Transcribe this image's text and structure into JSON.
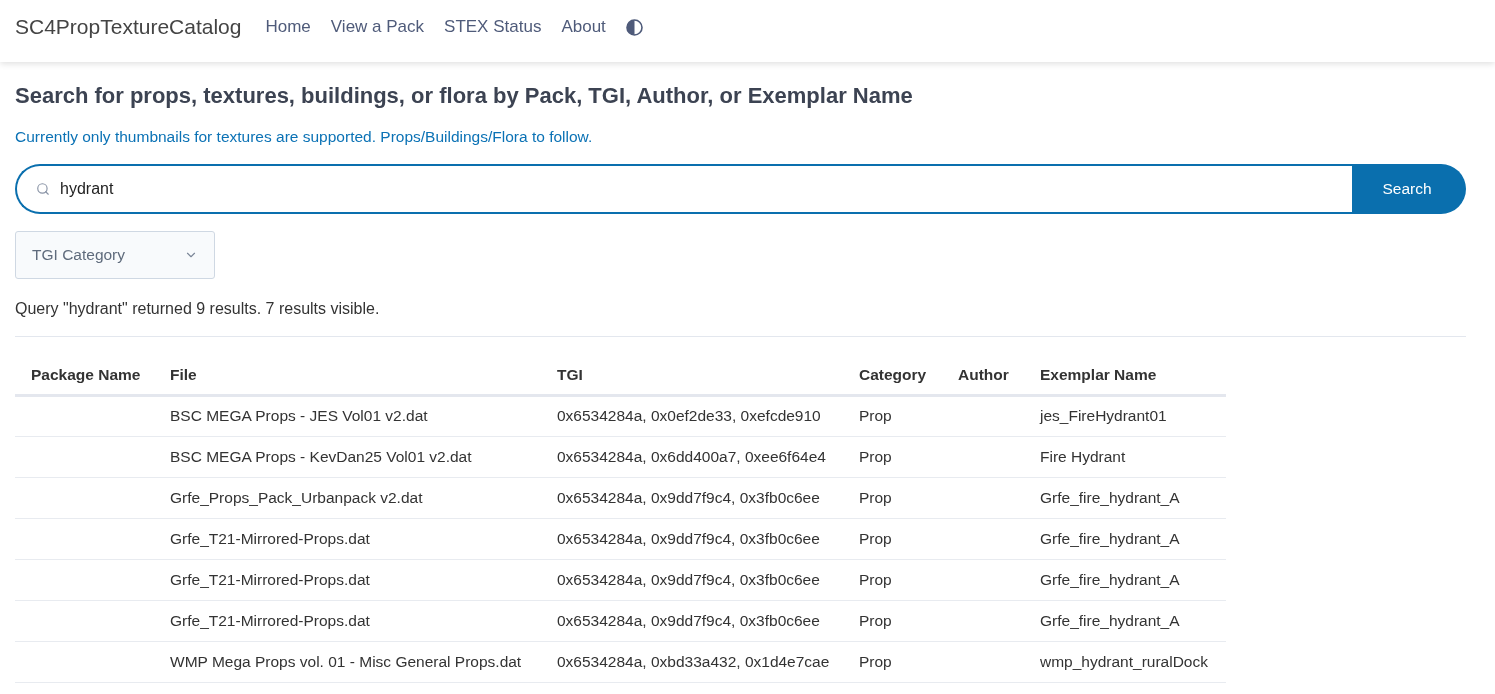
{
  "navbar": {
    "brand": "SC4PropTextureCatalog",
    "links": [
      "Home",
      "View a Pack",
      "STEX Status",
      "About"
    ]
  },
  "search": {
    "heading": "Search for props, textures, buildings, or flora by Pack, TGI, Author, or Exemplar Name",
    "notice": "Currently only thumbnails for textures are supported. Props/Buildings/Flora to follow.",
    "field": {
      "value": "hydrant"
    },
    "button": "Search",
    "category_select": {
      "placeholder": "TGI Category"
    }
  },
  "results": {
    "summary": "Query \"hydrant\" returned 9 results. 7 results visible.",
    "columns": [
      "Package Name",
      "File",
      "TGI",
      "Category",
      "Author",
      "Exemplar Name"
    ],
    "rows": [
      {
        "file": "BSC MEGA Props - JES Vol01 v2.dat",
        "tgi": "0x6534284a, 0x0ef2de33, 0xefcde910",
        "category": "Prop",
        "exemplar_name": "jes_FireHydrant01"
      },
      {
        "file": "BSC MEGA Props - KevDan25 Vol01 v2.dat",
        "tgi": "0x6534284a, 0x6dd400a7, 0xee6f64e4",
        "category": "Prop",
        "exemplar_name": "Fire Hydrant"
      },
      {
        "file": "Grfe_Props_Pack_Urbanpack v2.dat",
        "tgi": "0x6534284a, 0x9dd7f9c4, 0x3fb0c6ee",
        "category": "Prop",
        "exemplar_name": "Grfe_fire_hydrant_A"
      },
      {
        "file": "Grfe_T21-Mirrored-Props.dat",
        "tgi": "0x6534284a, 0x9dd7f9c4, 0x3fb0c6ee",
        "category": "Prop",
        "exemplar_name": "Grfe_fire_hydrant_A"
      },
      {
        "file": "Grfe_T21-Mirrored-Props.dat",
        "tgi": "0x6534284a, 0x9dd7f9c4, 0x3fb0c6ee",
        "category": "Prop",
        "exemplar_name": "Grfe_fire_hydrant_A"
      },
      {
        "file": "Grfe_T21-Mirrored-Props.dat",
        "tgi": "0x6534284a, 0x9dd7f9c4, 0x3fb0c6ee",
        "category": "Prop",
        "exemplar_name": "Grfe_fire_hydrant_A"
      },
      {
        "file": "WMP Mega Props vol. 01 - Misc General Props.dat",
        "tgi": "0x6534284a, 0xbd33a432, 0x1d4e7cae",
        "category": "Prop",
        "exemplar_name": "wmp_hydrant_ruralDock"
      }
    ]
  }
}
